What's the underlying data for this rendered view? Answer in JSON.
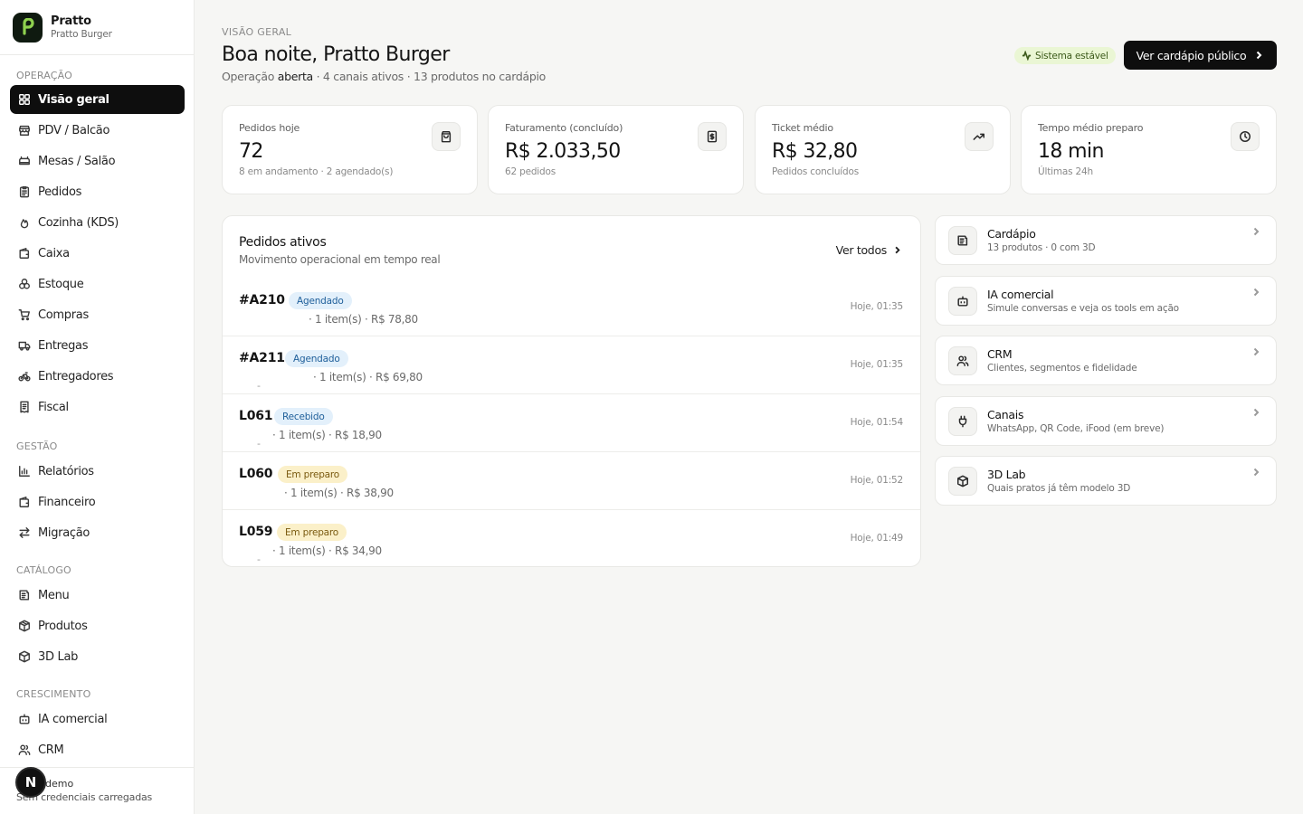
{
  "brand": {
    "name": "Pratto",
    "subtitle": "Pratto Burger"
  },
  "sidebar": {
    "sections": {
      "operacao": "OPERAÇÃO",
      "gestao": "GESTÃO",
      "catalogo": "CATÁLOGO",
      "crescimento": "CRESCIMENTO"
    },
    "items": [
      {
        "label": "Visão geral",
        "icon": "grid-icon"
      },
      {
        "label": "PDV / Balcão",
        "icon": "store-icon"
      },
      {
        "label": "Mesas / Salão",
        "icon": "table-icon"
      },
      {
        "label": "Pedidos",
        "icon": "clipboard-icon"
      },
      {
        "label": "Cozinha (KDS)",
        "icon": "flame-icon"
      },
      {
        "label": "Caixa",
        "icon": "wallet-icon"
      },
      {
        "label": "Estoque",
        "icon": "boxes-icon"
      },
      {
        "label": "Compras",
        "icon": "cart-icon"
      },
      {
        "label": "Entregas",
        "icon": "truck-icon"
      },
      {
        "label": "Entregadores",
        "icon": "bike-icon"
      },
      {
        "label": "Fiscal",
        "icon": "receipt-icon"
      },
      {
        "label": "Relatórios",
        "icon": "bar-chart-icon"
      },
      {
        "label": "Financeiro",
        "icon": "wallet-icon"
      },
      {
        "label": "Migração",
        "icon": "arrows-icon"
      },
      {
        "label": "Menu",
        "icon": "menu-book-icon"
      },
      {
        "label": "Produtos",
        "icon": "package-icon"
      },
      {
        "label": "3D Lab",
        "icon": "cube-icon"
      },
      {
        "label": "IA comercial",
        "icon": "bot-icon"
      },
      {
        "label": "CRM",
        "icon": "users-icon"
      }
    ],
    "footer": {
      "avatar": "N",
      "name": "demo",
      "subtitle": "Sem credenciais carregadas"
    }
  },
  "header": {
    "eyebrow": "VISÃO GERAL",
    "greeting": "Boa noite, Pratto Burger",
    "sub_prefix": "Operação ",
    "sub_status": "aberta",
    "sub_suffix": " · 4 canais ativos · 13 produtos no cardápio",
    "status_pill": "Sistema estável",
    "cta": "Ver cardápio público"
  },
  "stats": [
    {
      "label": "Pedidos hoje",
      "value": "72",
      "note": "8 em andamento · 2 agendado(s)",
      "icon": "shopping-bag-icon"
    },
    {
      "label": "Faturamento (concluído)",
      "value": "R$ 2.033,50",
      "note": "62 pedidos",
      "icon": "dollar-doc-icon"
    },
    {
      "label": "Ticket médio",
      "value": "R$ 32,80",
      "note": "Pedidos concluídos",
      "icon": "trending-up-icon"
    },
    {
      "label": "Tempo médio preparo",
      "value": "18 min",
      "note": "Últimas 24h",
      "icon": "clock-icon"
    }
  ],
  "orders": {
    "title": "Pedidos ativos",
    "subtitle": "Movimento operacional em tempo real",
    "see_all": "Ver todos",
    "rows": [
      {
        "id": "#A210",
        "status": "Agendado",
        "meta": "· 1 item(s) · R$ 78,80",
        "time": "Hoje, 01:35"
      },
      {
        "id": "#A211",
        "status": "Agendado",
        "meta": "· 1 item(s) · R$ 69,80",
        "time": "Hoje, 01:35"
      },
      {
        "id": "L061",
        "status": "Recebido",
        "meta": "· 1 item(s) · R$ 18,90",
        "time": "Hoje, 01:54"
      },
      {
        "id": "L060",
        "status": "Em preparo",
        "meta": "· 1 item(s) · R$ 38,90",
        "time": "Hoje, 01:52"
      },
      {
        "id": "L059",
        "status": "Em preparo",
        "meta": "· 1 item(s) · R$ 34,90",
        "time": "Hoje, 01:49"
      }
    ]
  },
  "links": [
    {
      "title": "Cardápio",
      "subtitle": "13 produtos · 0 com 3D",
      "icon": "menu-book-icon"
    },
    {
      "title": "IA comercial",
      "subtitle": "Simule conversas e veja os tools em ação",
      "icon": "bot-icon"
    },
    {
      "title": "CRM",
      "subtitle": "Clientes, segmentos e fidelidade",
      "icon": "users-icon"
    },
    {
      "title": "Canais",
      "subtitle": "WhatsApp, QR Code, iFood (em breve)",
      "icon": "plug-icon"
    },
    {
      "title": "3D Lab",
      "subtitle": "Quais pratos já têm modelo 3D",
      "icon": "cube-icon"
    }
  ],
  "colors": {
    "accent_dark": "#0e0e0e",
    "brand_green": "#8fd14f",
    "status_green_bg": "#eaf6d4",
    "badge_blue_bg": "#e3f0fb",
    "badge_yellow_bg": "#fbf0c9"
  }
}
